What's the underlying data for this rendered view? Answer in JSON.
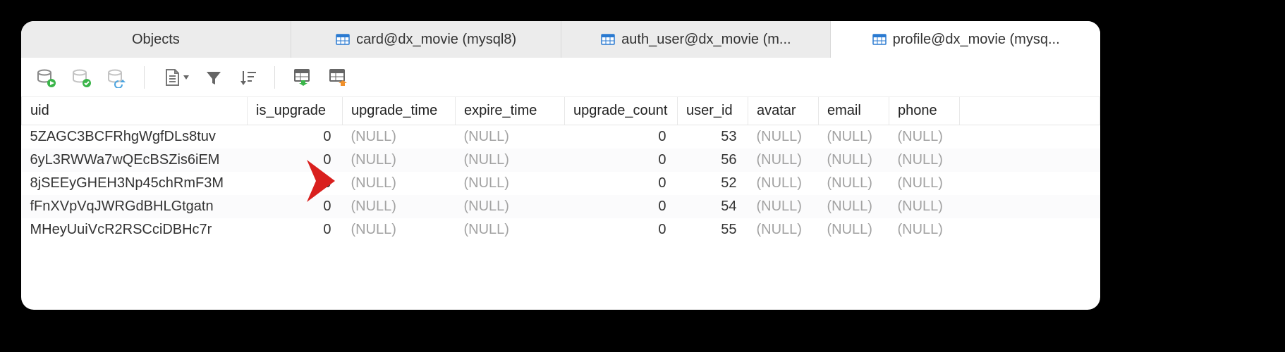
{
  "tabs": [
    {
      "label": "Objects",
      "icon": null,
      "active": false
    },
    {
      "label": "card@dx_movie (mysql8)",
      "icon": "table",
      "active": false
    },
    {
      "label": "auth_user@dx_movie (m...",
      "icon": "table",
      "active": false
    },
    {
      "label": "profile@dx_movie (mysq...",
      "icon": "table",
      "active": true
    }
  ],
  "columns": {
    "uid": "uid",
    "is_upgrade": "is_upgrade",
    "upgrade_time": "upgrade_time",
    "expire_time": "expire_time",
    "upgrade_count": "upgrade_count",
    "user_id": "user_id",
    "avatar": "avatar",
    "email": "email",
    "phone": "phone"
  },
  "null_text": "(NULL)",
  "rows": [
    {
      "uid": "5ZAGC3BCFRhgWgfDLs8tuv",
      "is_upgrade": "0",
      "upgrade_time": null,
      "expire_time": null,
      "upgrade_count": "0",
      "user_id": "53",
      "avatar": null,
      "email": null,
      "phone": null
    },
    {
      "uid": "6yL3RWWa7wQEcBSZis6iEM",
      "is_upgrade": "0",
      "upgrade_time": null,
      "expire_time": null,
      "upgrade_count": "0",
      "user_id": "56",
      "avatar": null,
      "email": null,
      "phone": null
    },
    {
      "uid": "8jSEEyGHEH3Np45chRmF3M",
      "is_upgrade": "0",
      "upgrade_time": null,
      "expire_time": null,
      "upgrade_count": "0",
      "user_id": "52",
      "avatar": null,
      "email": null,
      "phone": null
    },
    {
      "uid": "fFnXVpVqJWRGdBHLGtgatn",
      "is_upgrade": "0",
      "upgrade_time": null,
      "expire_time": null,
      "upgrade_count": "0",
      "user_id": "54",
      "avatar": null,
      "email": null,
      "phone": null
    },
    {
      "uid": "MHeyUuiVcR2RSCciDBHc7r",
      "is_upgrade": "0",
      "upgrade_time": null,
      "expire_time": null,
      "upgrade_count": "0",
      "user_id": "55",
      "avatar": null,
      "email": null,
      "phone": null
    }
  ]
}
